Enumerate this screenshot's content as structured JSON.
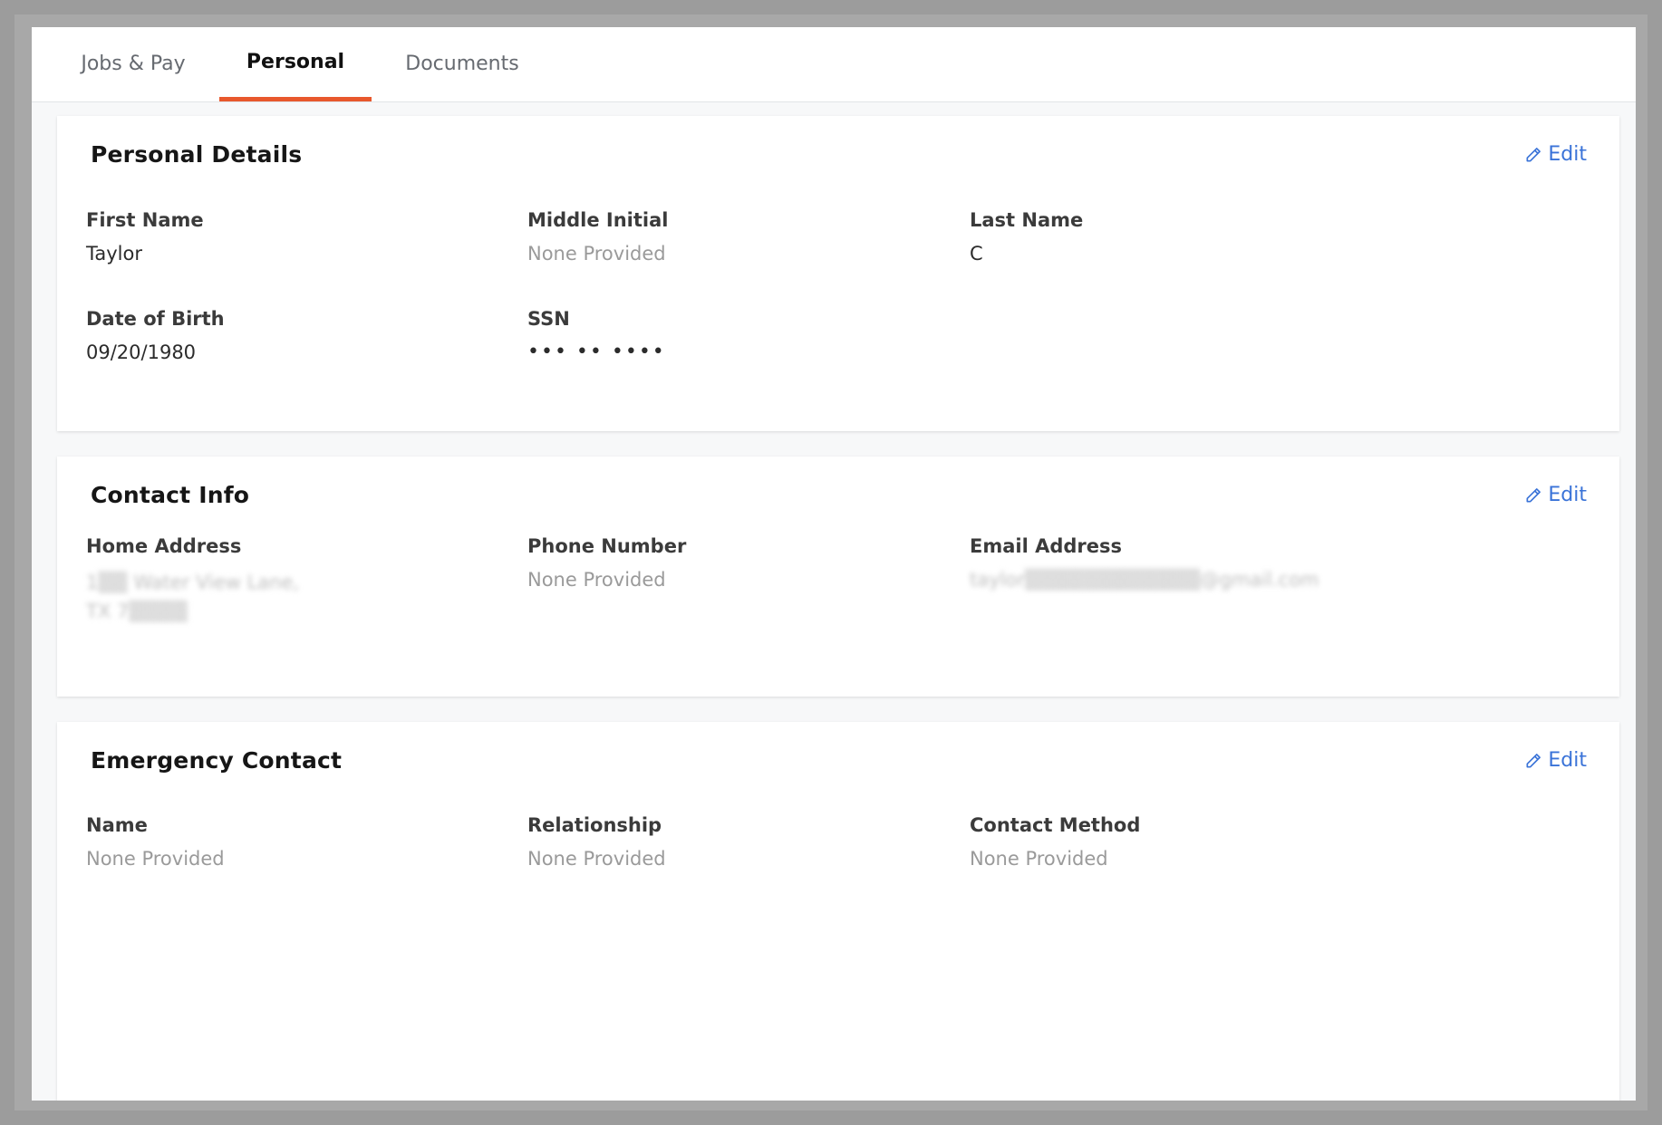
{
  "tabs": [
    {
      "label": "Jobs & Pay"
    },
    {
      "label": "Personal"
    },
    {
      "label": "Documents"
    }
  ],
  "personal_details": {
    "title": "Personal Details",
    "edit_label": "Edit",
    "fields": {
      "first_name": {
        "label": "First Name",
        "value": "Taylor"
      },
      "middle_initial": {
        "label": "Middle Initial",
        "value": "None Provided"
      },
      "last_name": {
        "label": "Last Name",
        "value": "C"
      },
      "dob": {
        "label": "Date of Birth",
        "value": "09/20/1980"
      },
      "ssn": {
        "label": "SSN",
        "value": "••• •• ••••"
      }
    }
  },
  "contact_info": {
    "title": "Contact Info",
    "edit_label": "Edit",
    "fields": {
      "home_address": {
        "label": "Home Address",
        "line1": "1▒▒ Water View Lane,",
        "line2": "TX 7▒▒▒▒"
      },
      "phone": {
        "label": "Phone Number",
        "value": "None Provided"
      },
      "email": {
        "label": "Email Address",
        "value": "taylor▒▒▒▒▒▒▒▒▒▒▒▒@gmail.com"
      }
    }
  },
  "emergency_contact": {
    "title": "Emergency Contact",
    "edit_label": "Edit",
    "fields": {
      "name": {
        "label": "Name",
        "value": "None Provided"
      },
      "relationship": {
        "label": "Relationship",
        "value": "None Provided"
      },
      "contact_method": {
        "label": "Contact Method",
        "value": "None Provided"
      }
    }
  },
  "colors": {
    "accent": "#e8582c",
    "link": "#3a73d8",
    "muted": "#9a9a9a"
  }
}
